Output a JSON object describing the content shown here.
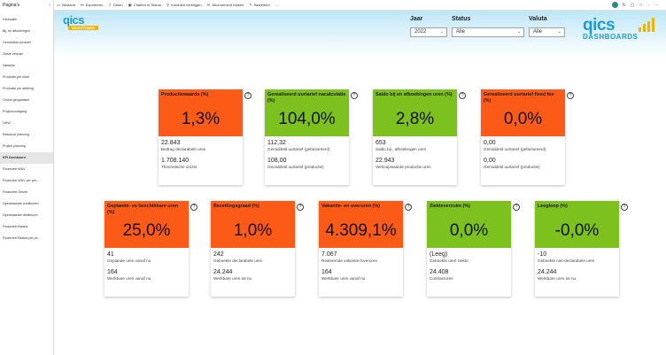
{
  "pages_pane": {
    "title": "Pagina's",
    "items": [
      "Facturatie",
      "Bij- en afboekingen",
      "Gemiddeld uurtarief",
      "Ziekte verzuim",
      "Vakantie",
      "Productie per klant",
      "Productie per afdeling",
      "Omzet geografisch",
      "Projectvoortgang",
      "OHW",
      "Resource planning",
      "Project planning",
      "KPI Dashboard",
      "Financieel W&V",
      "Financieel W&V per per...",
      "Financieel Omzet",
      "Openstaande crediteuren",
      "Openstaande debiteuren",
      "Financieel Balans",
      "Financieel Balans per pe..."
    ],
    "active_index": 12
  },
  "toolbar": {
    "items": [
      {
        "icon": "file-icon",
        "glyph": "▭",
        "label": "Bestand"
      },
      {
        "icon": "export-icon",
        "glyph": "↦",
        "label": "Exporteren"
      },
      {
        "icon": "share-icon",
        "glyph": "⇪",
        "label": "Delen"
      },
      {
        "icon": "teams-icon",
        "glyph": "▣",
        "label": "Chatten in Teams"
      },
      {
        "icon": "insights-icon",
        "glyph": "⚲",
        "label": "Inzichten verkrijgen"
      },
      {
        "icon": "subscribe-icon",
        "glyph": "✉",
        "label": "Abonnement maken"
      },
      {
        "icon": "edit-icon",
        "glyph": "✎",
        "label": "Bewerken"
      },
      {
        "icon": "more-icon",
        "glyph": "…",
        "label": ""
      }
    ]
  },
  "logo_left": {
    "text": "qics",
    "sub": "MILESTONES"
  },
  "logo_right": {
    "text": "qics",
    "sub": "DASHBOARDS"
  },
  "slicers": {
    "jaar": {
      "label": "Jaar",
      "value": "2022"
    },
    "status": {
      "label": "Status",
      "value": "Alle"
    },
    "valuta": {
      "label": "Valuta",
      "value": "Alle"
    }
  },
  "colors": {
    "orange": "#fc5a17",
    "green": "#7cc11d",
    "accent": "#1c9ad6"
  },
  "cards": [
    {
      "title": "Productiewaarde (%)",
      "value": "1,3%",
      "color": "orange",
      "v1": "22.843",
      "c1": "Bedrag declarabele uren",
      "v2": "1.708.140",
      "c2": "Theoretische omzet"
    },
    {
      "title": "Gerealiseerd uurtarief nacalculatie (%)",
      "value": "104,0%",
      "color": "green",
      "v1": "112,32",
      "c1": "Gemiddeld uurtarief (gefactureerd)",
      "v2": "108,00",
      "c2": "Gemiddeld uurtarief (productie)"
    },
    {
      "title": "Saldo bij en afboekingen uren (%)",
      "value": "2,8%",
      "color": "green",
      "v1": "653",
      "c1": "Saldo bij-, afboekingen uren",
      "v2": "22.943",
      "c2": "Verkoopwaarde productie uren"
    },
    {
      "title": "Gerealiseerd uurtarief fixed fee (%)",
      "value": "0,0%",
      "color": "orange",
      "v1": "0,00",
      "c1": "Gemiddeld uurtarief (gefactureerd)",
      "v2": "0,00",
      "c2": "Gemiddeld uurtarief (productie)"
    },
    {
      "title": "Geplande- vs beschikbare uren (%)",
      "value": "25,0%",
      "color": "orange",
      "v1": "41",
      "c1": "Geplande uren vanaf nu",
      "v2": "164",
      "c2": "Werkbare uren vanaf nu"
    },
    {
      "title": "Bezettingsgraad (%)",
      "value": "1,0%",
      "color": "orange",
      "v1": "242",
      "c1": "Geboekte declarabele uren",
      "v2": "24.244",
      "c2": "Werkbare uren tot nu"
    },
    {
      "title": "Vakantie- en overuren (%)",
      "value": "4.309,1%",
      "color": "orange",
      "v1": "7.067",
      "c1": "Resterende vakantie-/overuren",
      "v2": "164",
      "c2": "Werkbare uren vanaf nu"
    },
    {
      "title": "Ziekteverzuim (%)",
      "value": "0,0%",
      "color": "green",
      "v1": "(Leeg)",
      "c1": "Geboekte uren ziekte",
      "v2": "24.408",
      "c2": "Contracturen"
    },
    {
      "title": "Leegloop (%)",
      "value": "-0,0%",
      "color": "green",
      "v1": "-10",
      "c1": "Geboekte niet-declarabele uren",
      "v2": "24.244",
      "c2": "Werkbare uren tot nu"
    }
  ],
  "help_glyph": "?"
}
